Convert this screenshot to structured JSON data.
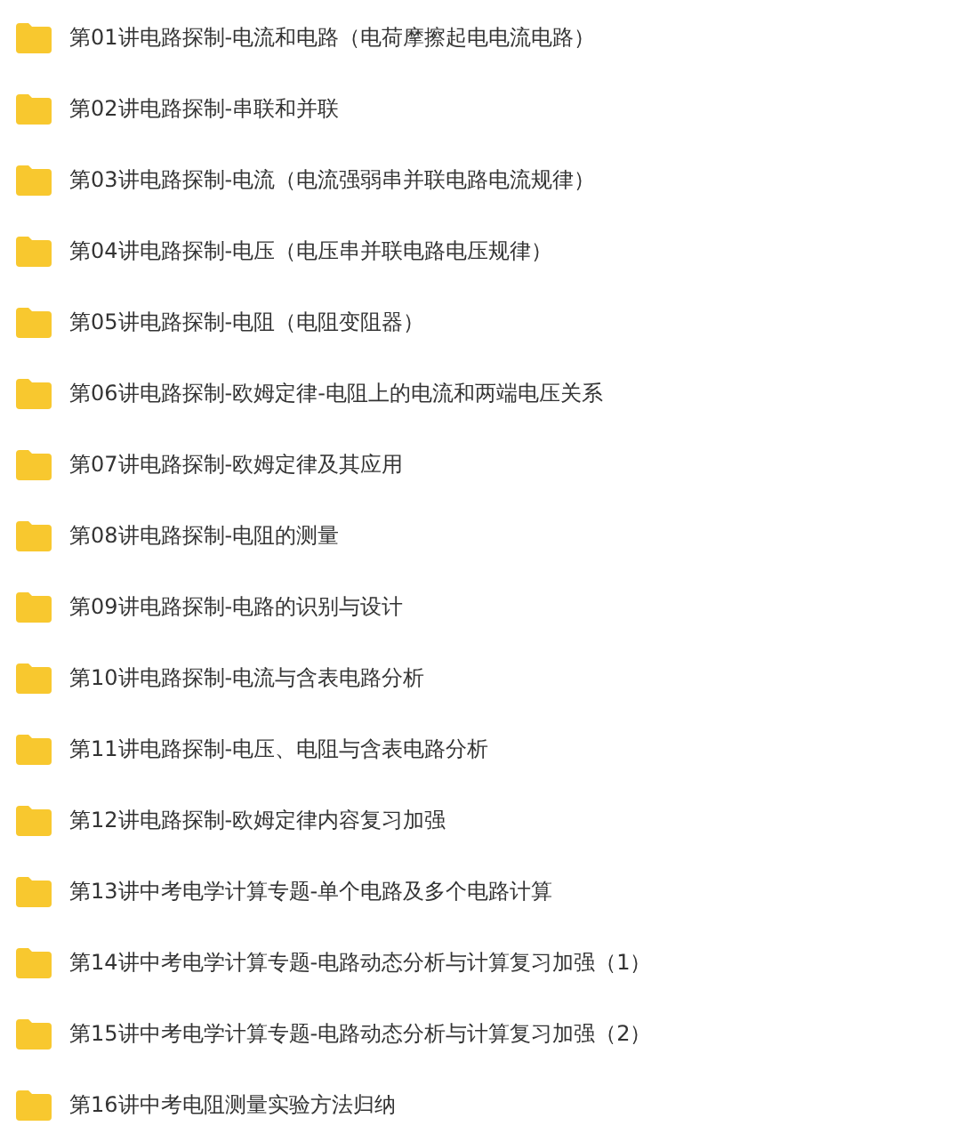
{
  "folders": [
    {
      "name": "第01讲电路探制-电流和电路（电荷摩擦起电电流电路）"
    },
    {
      "name": "第02讲电路探制-串联和并联"
    },
    {
      "name": "第03讲电路探制-电流（电流强弱串并联电路电流规律）"
    },
    {
      "name": "第04讲电路探制-电压（电压串并联电路电压规律）"
    },
    {
      "name": "第05讲电路探制-电阻（电阻变阻器）"
    },
    {
      "name": "第06讲电路探制-欧姆定律-电阻上的电流和两端电压关系"
    },
    {
      "name": "第07讲电路探制-欧姆定律及其应用"
    },
    {
      "name": "第08讲电路探制-电阻的测量"
    },
    {
      "name": "第09讲电路探制-电路的识别与设计"
    },
    {
      "name": "第10讲电路探制-电流与含表电路分析"
    },
    {
      "name": "第11讲电路探制-电压、电阻与含表电路分析"
    },
    {
      "name": "第12讲电路探制-欧姆定律内容复习加强"
    },
    {
      "name": "第13讲中考电学计算专题-单个电路及多个电路计算"
    },
    {
      "name": "第14讲中考电学计算专题-电路动态分析与计算复习加强（1）"
    },
    {
      "name": "第15讲中考电学计算专题-电路动态分析与计算复习加强（2）"
    },
    {
      "name": "第16讲中考电阻测量实验方法归纳"
    }
  ]
}
